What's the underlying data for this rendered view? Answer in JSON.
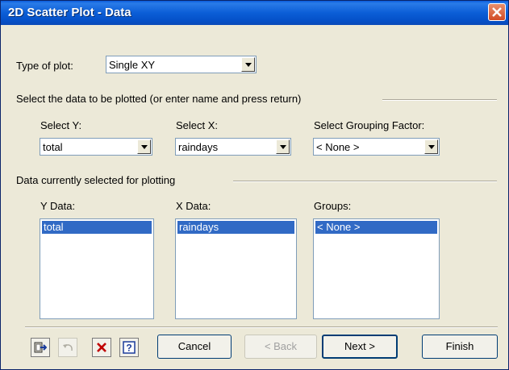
{
  "window": {
    "title": "2D Scatter Plot - Data"
  },
  "plot_type": {
    "label": "Type of plot:",
    "value": "Single XY"
  },
  "select_section": {
    "heading": "Select the data to be plotted (or enter name and press return)"
  },
  "select_y": {
    "label": "Select Y:",
    "value": "total"
  },
  "select_x": {
    "label": "Select X:",
    "value": "raindays"
  },
  "select_group": {
    "label": "Select Grouping Factor:",
    "value": "< None >"
  },
  "current_section": {
    "heading": "Data currently selected for plotting"
  },
  "y_data": {
    "label": "Y Data:",
    "items": [
      "total"
    ]
  },
  "x_data": {
    "label": "X Data:",
    "items": [
      "raindays"
    ]
  },
  "groups": {
    "label": "Groups:",
    "items": [
      "< None >"
    ]
  },
  "buttons": {
    "cancel": "Cancel",
    "back": "< Back",
    "next": "Next >",
    "finish": "Finish"
  },
  "icons": [
    "exit-icon",
    "undo-icon",
    "delete-icon",
    "help-icon"
  ],
  "colors": {
    "titlebar": "#0a5cdc",
    "selection": "#316ac5",
    "dialog_bg": "#ece9d8",
    "delete_x": "#c00000"
  }
}
